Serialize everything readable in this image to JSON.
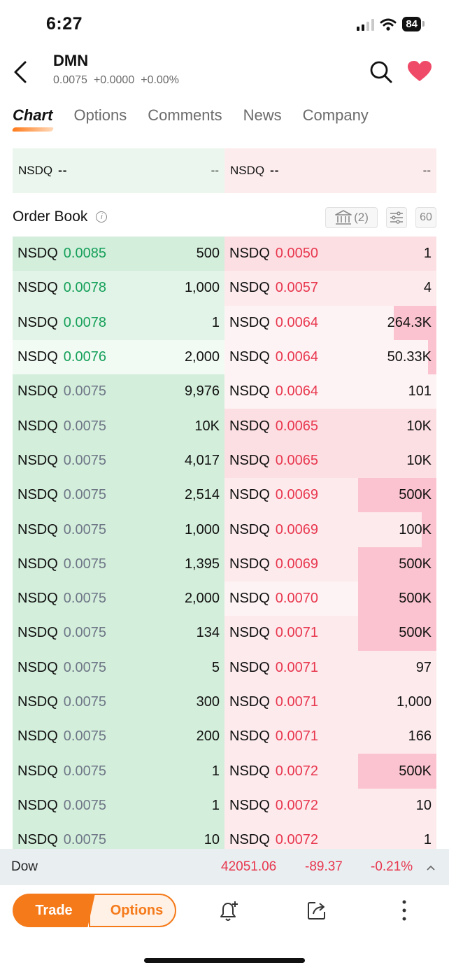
{
  "status_bar": {
    "time": "6:27",
    "battery": "84"
  },
  "header": {
    "symbol": "DMN",
    "price": "0.0075",
    "change": "+0.0000",
    "change_pct": "+0.00%"
  },
  "tabs": [
    "Chart",
    "Options",
    "Comments",
    "News",
    "Company"
  ],
  "nbbo": {
    "bid": {
      "exchange": "NSDQ",
      "price": "--",
      "size": "--"
    },
    "ask": {
      "exchange": "NSDQ",
      "price": "--",
      "size": "--"
    }
  },
  "order_book": {
    "title": "Order Book",
    "exchange_count": "(2)",
    "depth_label": "60"
  },
  "bids": [
    {
      "ex": "NSDQ",
      "price": "0.0085",
      "size": "500",
      "color": "green",
      "bar": 1.0,
      "bg": "#d3eedb"
    },
    {
      "ex": "NSDQ",
      "price": "0.0078",
      "size": "1,000",
      "color": "green",
      "bar": 1.0,
      "bg": "#e2f4e7"
    },
    {
      "ex": "NSDQ",
      "price": "0.0078",
      "size": "1",
      "color": "green",
      "bar": 1.0,
      "bg": "#e2f4e7"
    },
    {
      "ex": "NSDQ",
      "price": "0.0076",
      "size": "2,000",
      "color": "green",
      "bar": 1.0,
      "bg": "#f1faf3"
    },
    {
      "ex": "NSDQ",
      "price": "0.0075",
      "size": "9,976",
      "color": "grey",
      "bar": 1.0,
      "bg": "#d3eedb"
    },
    {
      "ex": "NSDQ",
      "price": "0.0075",
      "size": "10K",
      "color": "grey",
      "bar": 1.0,
      "bg": "#d3eedb"
    },
    {
      "ex": "NSDQ",
      "price": "0.0075",
      "size": "4,017",
      "color": "grey",
      "bar": 1.0,
      "bg": "#d3eedb"
    },
    {
      "ex": "NSDQ",
      "price": "0.0075",
      "size": "2,514",
      "color": "grey",
      "bar": 1.0,
      "bg": "#d3eedb"
    },
    {
      "ex": "NSDQ",
      "price": "0.0075",
      "size": "1,000",
      "color": "grey",
      "bar": 1.0,
      "bg": "#d3eedb"
    },
    {
      "ex": "NSDQ",
      "price": "0.0075",
      "size": "1,395",
      "color": "grey",
      "bar": 1.0,
      "bg": "#d3eedb"
    },
    {
      "ex": "NSDQ",
      "price": "0.0075",
      "size": "2,000",
      "color": "grey",
      "bar": 1.0,
      "bg": "#d3eedb"
    },
    {
      "ex": "NSDQ",
      "price": "0.0075",
      "size": "134",
      "color": "grey",
      "bar": 1.0,
      "bg": "#d3eedb"
    },
    {
      "ex": "NSDQ",
      "price": "0.0075",
      "size": "5",
      "color": "grey",
      "bar": 1.0,
      "bg": "#d3eedb"
    },
    {
      "ex": "NSDQ",
      "price": "0.0075",
      "size": "300",
      "color": "grey",
      "bar": 1.0,
      "bg": "#d3eedb"
    },
    {
      "ex": "NSDQ",
      "price": "0.0075",
      "size": "200",
      "color": "grey",
      "bar": 1.0,
      "bg": "#d3eedb"
    },
    {
      "ex": "NSDQ",
      "price": "0.0075",
      "size": "1",
      "color": "grey",
      "bar": 1.0,
      "bg": "#d3eedb"
    },
    {
      "ex": "NSDQ",
      "price": "0.0075",
      "size": "1",
      "color": "grey",
      "bar": 1.0,
      "bg": "#d3eedb"
    },
    {
      "ex": "NSDQ",
      "price": "0.0075",
      "size": "10",
      "color": "grey",
      "bar": 1.0,
      "bg": "#d3eedb"
    }
  ],
  "asks": [
    {
      "ex": "NSDQ",
      "price": "0.0050",
      "size": "1",
      "row_bg": "#fcdfe3",
      "bar": 0.0
    },
    {
      "ex": "NSDQ",
      "price": "0.0057",
      "size": "4",
      "row_bg": "#fdeaed",
      "bar": 0.0
    },
    {
      "ex": "NSDQ",
      "price": "0.0064",
      "size": "264.3K",
      "row_bg": "#fef3f4",
      "bar": 0.2
    },
    {
      "ex": "NSDQ",
      "price": "0.0064",
      "size": "50.33K",
      "row_bg": "#fef3f4",
      "bar": 0.04
    },
    {
      "ex": "NSDQ",
      "price": "0.0064",
      "size": "101",
      "row_bg": "#fef3f4",
      "bar": 0.0
    },
    {
      "ex": "NSDQ",
      "price": "0.0065",
      "size": "10K",
      "row_bg": "#fcdfe3",
      "bar": 0.0
    },
    {
      "ex": "NSDQ",
      "price": "0.0065",
      "size": "10K",
      "row_bg": "#fcdfe3",
      "bar": 0.0
    },
    {
      "ex": "NSDQ",
      "price": "0.0069",
      "size": "500K",
      "row_bg": "#fdeaed",
      "bar": 0.37
    },
    {
      "ex": "NSDQ",
      "price": "0.0069",
      "size": "100K",
      "row_bg": "#fdeaed",
      "bar": 0.07
    },
    {
      "ex": "NSDQ",
      "price": "0.0069",
      "size": "500K",
      "row_bg": "#fdeaed",
      "bar": 0.37
    },
    {
      "ex": "NSDQ",
      "price": "0.0070",
      "size": "500K",
      "row_bg": "#fef3f4",
      "bar": 0.37
    },
    {
      "ex": "NSDQ",
      "price": "0.0071",
      "size": "500K",
      "row_bg": "#fdeaed",
      "bar": 0.37
    },
    {
      "ex": "NSDQ",
      "price": "0.0071",
      "size": "97",
      "row_bg": "#fdeaed",
      "bar": 0.0
    },
    {
      "ex": "NSDQ",
      "price": "0.0071",
      "size": "1,000",
      "row_bg": "#fdeaed",
      "bar": 0.0
    },
    {
      "ex": "NSDQ",
      "price": "0.0071",
      "size": "166",
      "row_bg": "#fdeaed",
      "bar": 0.0
    },
    {
      "ex": "NSDQ",
      "price": "0.0072",
      "size": "500K",
      "row_bg": "#fdeaed",
      "bar": 0.37
    },
    {
      "ex": "NSDQ",
      "price": "0.0072",
      "size": "10",
      "row_bg": "#fdeaed",
      "bar": 0.0
    },
    {
      "ex": "NSDQ",
      "price": "0.0072",
      "size": "1",
      "row_bg": "#fdeaed",
      "bar": 0.0
    }
  ],
  "index_ticker": {
    "name": "Dow",
    "price": "42051.06",
    "change": "-89.37",
    "change_pct": "-0.21%"
  },
  "toolbar": {
    "trade": "Trade",
    "options": "Options"
  },
  "colors": {
    "accent": "#f57a1a",
    "up": "#16a05a",
    "down": "#e8384f",
    "bar_strong": "#fbc3cf"
  }
}
